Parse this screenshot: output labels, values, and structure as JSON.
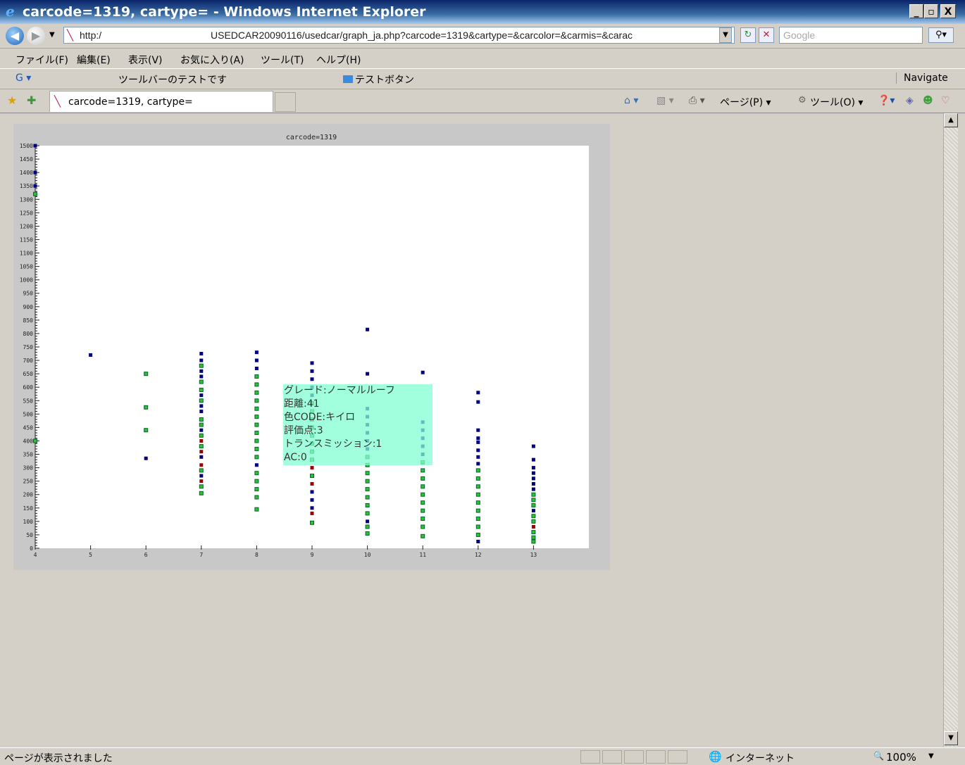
{
  "window": {
    "title": "carcode=1319, cartype= - Windows Internet Explorer",
    "btn_min": "_",
    "btn_max": "▫",
    "btn_close": "X"
  },
  "address": {
    "prefix": "http:/",
    "url": "USEDCAR20090116/usedcar/graph_ja.php?carcode=1319&cartype=&carcolor=&carmis=&carac",
    "search_placeholder": "Google"
  },
  "menu": [
    "ファイル(F)",
    "編集(E)",
    "表示(V)",
    "お気に入り(A)",
    "ツール(T)",
    "ヘルプ(H)"
  ],
  "toolbar": {
    "g_label": "G ▾",
    "test_text": "ツールバーのテストです",
    "test_button": "テストボタン",
    "navigate": "Navigate"
  },
  "tab": {
    "label": "carcode=1319, cartype="
  },
  "commandbar": {
    "page": "ページ(P) ▾",
    "tools": "ツール(O) ▾"
  },
  "tooltip": {
    "lines": [
      "グレード:ノーマルルーフ",
      "距離:41",
      "色CODE:キイロ",
      "評価点:3",
      "トランスミッション:1",
      "AC:0"
    ]
  },
  "status": {
    "message": "ページが表示されました",
    "zone": "インターネット",
    "zoom": "100%"
  },
  "colors": {
    "blue": "#000080",
    "green": "#30c030",
    "red": "#a00000",
    "tooltip": "#90ffd8"
  },
  "chart_data": {
    "type": "scatter",
    "title": "carcode=1319",
    "xlim": [
      4,
      14
    ],
    "ylim": [
      0,
      1500
    ],
    "x_ticks": [
      4,
      5,
      6,
      7,
      8,
      9,
      10,
      11,
      12,
      13
    ],
    "y_ticks": [
      0,
      50,
      100,
      150,
      200,
      250,
      300,
      350,
      400,
      450,
      500,
      550,
      600,
      650,
      700,
      750,
      800,
      850,
      900,
      950,
      1000,
      1050,
      1100,
      1150,
      1200,
      1250,
      1300,
      1350,
      1400,
      1450,
      1500
    ],
    "points": [
      {
        "x": 4,
        "y": 1500,
        "c": "blue"
      },
      {
        "x": 4,
        "y": 1400,
        "c": "blue"
      },
      {
        "x": 4,
        "y": 1350,
        "c": "blue"
      },
      {
        "x": 4,
        "y": 1320,
        "c": "green"
      },
      {
        "x": 4,
        "y": 400,
        "c": "green"
      },
      {
        "x": 5,
        "y": 720,
        "c": "blue"
      },
      {
        "x": 6,
        "y": 650,
        "c": "green"
      },
      {
        "x": 6,
        "y": 525,
        "c": "green"
      },
      {
        "x": 6,
        "y": 440,
        "c": "green"
      },
      {
        "x": 6,
        "y": 335,
        "c": "blue"
      },
      {
        "x": 7,
        "y": 725,
        "c": "blue"
      },
      {
        "x": 7,
        "y": 700,
        "c": "blue"
      },
      {
        "x": 7,
        "y": 680,
        "c": "green"
      },
      {
        "x": 7,
        "y": 660,
        "c": "blue"
      },
      {
        "x": 7,
        "y": 640,
        "c": "blue"
      },
      {
        "x": 7,
        "y": 620,
        "c": "green"
      },
      {
        "x": 7,
        "y": 590,
        "c": "green"
      },
      {
        "x": 7,
        "y": 570,
        "c": "blue"
      },
      {
        "x": 7,
        "y": 550,
        "c": "green"
      },
      {
        "x": 7,
        "y": 530,
        "c": "blue"
      },
      {
        "x": 7,
        "y": 510,
        "c": "blue"
      },
      {
        "x": 7,
        "y": 480,
        "c": "green"
      },
      {
        "x": 7,
        "y": 460,
        "c": "green"
      },
      {
        "x": 7,
        "y": 440,
        "c": "blue"
      },
      {
        "x": 7,
        "y": 420,
        "c": "green"
      },
      {
        "x": 7,
        "y": 400,
        "c": "red"
      },
      {
        "x": 7,
        "y": 380,
        "c": "green"
      },
      {
        "x": 7,
        "y": 360,
        "c": "red"
      },
      {
        "x": 7,
        "y": 340,
        "c": "blue"
      },
      {
        "x": 7,
        "y": 310,
        "c": "red"
      },
      {
        "x": 7,
        "y": 290,
        "c": "green"
      },
      {
        "x": 7,
        "y": 270,
        "c": "blue"
      },
      {
        "x": 7,
        "y": 250,
        "c": "red"
      },
      {
        "x": 7,
        "y": 230,
        "c": "green"
      },
      {
        "x": 7,
        "y": 205,
        "c": "green"
      },
      {
        "x": 8,
        "y": 730,
        "c": "blue"
      },
      {
        "x": 8,
        "y": 700,
        "c": "blue"
      },
      {
        "x": 8,
        "y": 670,
        "c": "blue"
      },
      {
        "x": 8,
        "y": 640,
        "c": "green"
      },
      {
        "x": 8,
        "y": 610,
        "c": "green"
      },
      {
        "x": 8,
        "y": 580,
        "c": "green"
      },
      {
        "x": 8,
        "y": 550,
        "c": "green"
      },
      {
        "x": 8,
        "y": 520,
        "c": "green"
      },
      {
        "x": 8,
        "y": 490,
        "c": "green"
      },
      {
        "x": 8,
        "y": 460,
        "c": "green"
      },
      {
        "x": 8,
        "y": 430,
        "c": "green"
      },
      {
        "x": 8,
        "y": 400,
        "c": "green"
      },
      {
        "x": 8,
        "y": 370,
        "c": "green"
      },
      {
        "x": 8,
        "y": 340,
        "c": "green"
      },
      {
        "x": 8,
        "y": 310,
        "c": "blue"
      },
      {
        "x": 8,
        "y": 280,
        "c": "green"
      },
      {
        "x": 8,
        "y": 250,
        "c": "green"
      },
      {
        "x": 8,
        "y": 220,
        "c": "green"
      },
      {
        "x": 8,
        "y": 190,
        "c": "green"
      },
      {
        "x": 8,
        "y": 145,
        "c": "green"
      },
      {
        "x": 9,
        "y": 690,
        "c": "blue"
      },
      {
        "x": 9,
        "y": 660,
        "c": "blue"
      },
      {
        "x": 9,
        "y": 630,
        "c": "blue"
      },
      {
        "x": 9,
        "y": 600,
        "c": "blue"
      },
      {
        "x": 9,
        "y": 570,
        "c": "blue"
      },
      {
        "x": 9,
        "y": 540,
        "c": "green"
      },
      {
        "x": 9,
        "y": 510,
        "c": "green"
      },
      {
        "x": 9,
        "y": 480,
        "c": "green"
      },
      {
        "x": 9,
        "y": 450,
        "c": "green"
      },
      {
        "x": 9,
        "y": 420,
        "c": "green"
      },
      {
        "x": 9,
        "y": 390,
        "c": "green"
      },
      {
        "x": 9,
        "y": 360,
        "c": "green"
      },
      {
        "x": 9,
        "y": 330,
        "c": "green"
      },
      {
        "x": 9,
        "y": 300,
        "c": "red"
      },
      {
        "x": 9,
        "y": 270,
        "c": "green"
      },
      {
        "x": 9,
        "y": 240,
        "c": "red"
      },
      {
        "x": 9,
        "y": 210,
        "c": "blue"
      },
      {
        "x": 9,
        "y": 180,
        "c": "blue"
      },
      {
        "x": 9,
        "y": 150,
        "c": "blue"
      },
      {
        "x": 9,
        "y": 130,
        "c": "red"
      },
      {
        "x": 9,
        "y": 95,
        "c": "green"
      },
      {
        "x": 10,
        "y": 815,
        "c": "blue"
      },
      {
        "x": 10,
        "y": 650,
        "c": "blue"
      },
      {
        "x": 10,
        "y": 520,
        "c": "blue"
      },
      {
        "x": 10,
        "y": 490,
        "c": "blue"
      },
      {
        "x": 10,
        "y": 460,
        "c": "blue"
      },
      {
        "x": 10,
        "y": 430,
        "c": "blue"
      },
      {
        "x": 10,
        "y": 400,
        "c": "blue"
      },
      {
        "x": 10,
        "y": 370,
        "c": "blue"
      },
      {
        "x": 10,
        "y": 340,
        "c": "green"
      },
      {
        "x": 10,
        "y": 310,
        "c": "green"
      },
      {
        "x": 10,
        "y": 280,
        "c": "green"
      },
      {
        "x": 10,
        "y": 250,
        "c": "green"
      },
      {
        "x": 10,
        "y": 220,
        "c": "green"
      },
      {
        "x": 10,
        "y": 190,
        "c": "green"
      },
      {
        "x": 10,
        "y": 160,
        "c": "green"
      },
      {
        "x": 10,
        "y": 130,
        "c": "green"
      },
      {
        "x": 10,
        "y": 100,
        "c": "blue"
      },
      {
        "x": 10,
        "y": 80,
        "c": "green"
      },
      {
        "x": 10,
        "y": 55,
        "c": "green"
      },
      {
        "x": 11,
        "y": 655,
        "c": "blue"
      },
      {
        "x": 11,
        "y": 470,
        "c": "blue"
      },
      {
        "x": 11,
        "y": 440,
        "c": "blue"
      },
      {
        "x": 11,
        "y": 410,
        "c": "blue"
      },
      {
        "x": 11,
        "y": 380,
        "c": "blue"
      },
      {
        "x": 11,
        "y": 350,
        "c": "blue"
      },
      {
        "x": 11,
        "y": 320,
        "c": "green"
      },
      {
        "x": 11,
        "y": 290,
        "c": "green"
      },
      {
        "x": 11,
        "y": 260,
        "c": "green"
      },
      {
        "x": 11,
        "y": 230,
        "c": "green"
      },
      {
        "x": 11,
        "y": 200,
        "c": "green"
      },
      {
        "x": 11,
        "y": 170,
        "c": "green"
      },
      {
        "x": 11,
        "y": 140,
        "c": "green"
      },
      {
        "x": 11,
        "y": 110,
        "c": "green"
      },
      {
        "x": 11,
        "y": 80,
        "c": "green"
      },
      {
        "x": 11,
        "y": 45,
        "c": "green"
      },
      {
        "x": 12,
        "y": 580,
        "c": "blue"
      },
      {
        "x": 12,
        "y": 545,
        "c": "blue"
      },
      {
        "x": 12,
        "y": 440,
        "c": "blue"
      },
      {
        "x": 12,
        "y": 410,
        "c": "blue"
      },
      {
        "x": 12,
        "y": 395,
        "c": "blue"
      },
      {
        "x": 12,
        "y": 365,
        "c": "blue"
      },
      {
        "x": 12,
        "y": 340,
        "c": "blue"
      },
      {
        "x": 12,
        "y": 315,
        "c": "blue"
      },
      {
        "x": 12,
        "y": 290,
        "c": "green"
      },
      {
        "x": 12,
        "y": 260,
        "c": "green"
      },
      {
        "x": 12,
        "y": 230,
        "c": "green"
      },
      {
        "x": 12,
        "y": 200,
        "c": "green"
      },
      {
        "x": 12,
        "y": 170,
        "c": "green"
      },
      {
        "x": 12,
        "y": 140,
        "c": "green"
      },
      {
        "x": 12,
        "y": 110,
        "c": "green"
      },
      {
        "x": 12,
        "y": 80,
        "c": "green"
      },
      {
        "x": 12,
        "y": 50,
        "c": "green"
      },
      {
        "x": 12,
        "y": 25,
        "c": "blue"
      },
      {
        "x": 13,
        "y": 380,
        "c": "blue"
      },
      {
        "x": 13,
        "y": 330,
        "c": "blue"
      },
      {
        "x": 13,
        "y": 300,
        "c": "blue"
      },
      {
        "x": 13,
        "y": 280,
        "c": "blue"
      },
      {
        "x": 13,
        "y": 260,
        "c": "blue"
      },
      {
        "x": 13,
        "y": 240,
        "c": "blue"
      },
      {
        "x": 13,
        "y": 220,
        "c": "blue"
      },
      {
        "x": 13,
        "y": 200,
        "c": "green"
      },
      {
        "x": 13,
        "y": 180,
        "c": "green"
      },
      {
        "x": 13,
        "y": 160,
        "c": "green"
      },
      {
        "x": 13,
        "y": 140,
        "c": "blue"
      },
      {
        "x": 13,
        "y": 120,
        "c": "green"
      },
      {
        "x": 13,
        "y": 100,
        "c": "green"
      },
      {
        "x": 13,
        "y": 80,
        "c": "red"
      },
      {
        "x": 13,
        "y": 60,
        "c": "green"
      },
      {
        "x": 13,
        "y": 40,
        "c": "green"
      },
      {
        "x": 13,
        "y": 25,
        "c": "green"
      }
    ]
  }
}
